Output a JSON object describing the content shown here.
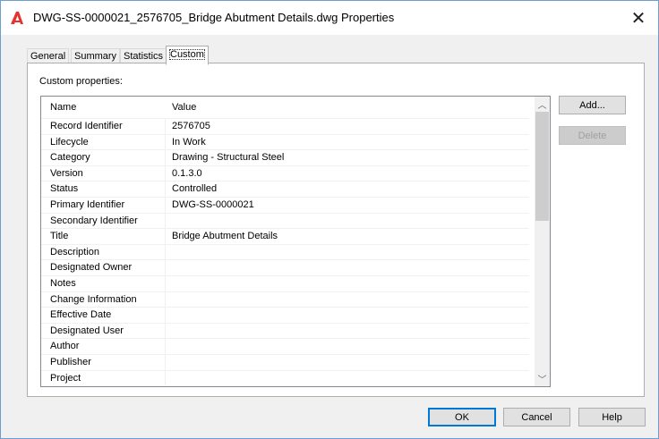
{
  "window": {
    "title": "DWG-SS-0000021_2576705_Bridge Abutment Details.dwg Properties",
    "close_glyph": "✕",
    "app_icon": "autocad-a-icon",
    "accent_color": "#e8312c"
  },
  "tabs": [
    {
      "label": "General"
    },
    {
      "label": "Summary"
    },
    {
      "label": "Statistics"
    },
    {
      "label": "Custom",
      "active": true
    }
  ],
  "custom": {
    "label": "Custom properties:",
    "columns": {
      "name": "Name",
      "value": "Value"
    },
    "rows": [
      {
        "name": "Record Identifier",
        "value": "2576705"
      },
      {
        "name": "Lifecycle",
        "value": "In Work"
      },
      {
        "name": "Category",
        "value": "Drawing - Structural Steel"
      },
      {
        "name": "Version",
        "value": "0.1.3.0"
      },
      {
        "name": "Status",
        "value": "Controlled"
      },
      {
        "name": "Primary Identifier",
        "value": "DWG-SS-0000021"
      },
      {
        "name": "Secondary Identifier",
        "value": ""
      },
      {
        "name": "Title",
        "value": "Bridge Abutment Details"
      },
      {
        "name": "Description",
        "value": ""
      },
      {
        "name": "Designated Owner",
        "value": ""
      },
      {
        "name": "Notes",
        "value": ""
      },
      {
        "name": "Change Information",
        "value": ""
      },
      {
        "name": "Effective Date",
        "value": ""
      },
      {
        "name": "Designated User",
        "value": ""
      },
      {
        "name": "Author",
        "value": ""
      },
      {
        "name": "Publisher",
        "value": ""
      },
      {
        "name": "Project",
        "value": ""
      }
    ],
    "add_button": "Add...",
    "delete_button": "Delete"
  },
  "footer": {
    "ok_button": "OK",
    "cancel_button": "Cancel",
    "help_button": "Help"
  }
}
